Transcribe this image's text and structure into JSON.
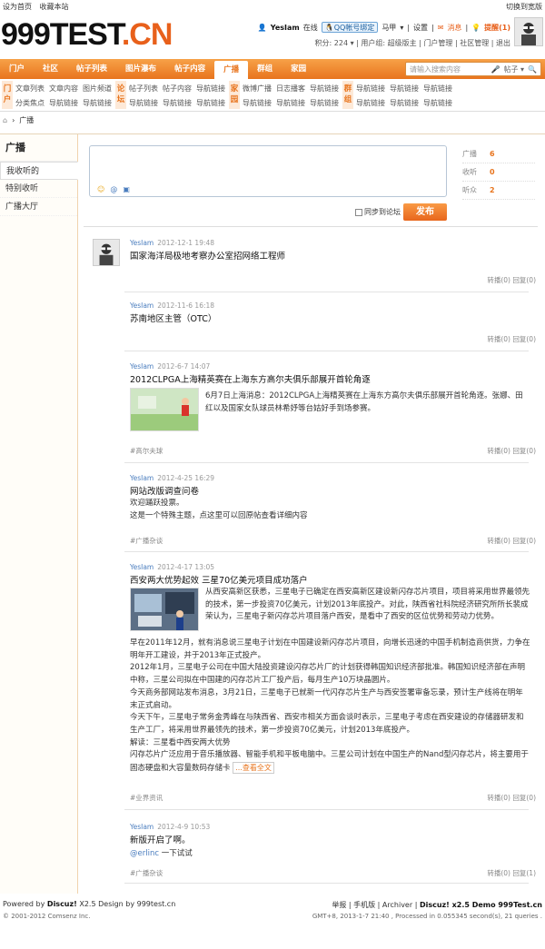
{
  "topbar": {
    "set_home": "设为首页",
    "bookmark": "收藏本站",
    "switch_style": "切换到宽版"
  },
  "logo": {
    "brand": "999TEST",
    "suffix": ".CN"
  },
  "user": {
    "name": "YesIam",
    "status": "在线",
    "qq_bind": "QQ帐号绑定",
    "horse": "马甲",
    "settings": "设置",
    "messages": "消息",
    "reminders": "提醒(1)",
    "credits": "积分: 224",
    "group": "用户组: 超级版主",
    "portal_mgmt": "门户管理",
    "community_mgmt": "社区管理",
    "logout": "退出"
  },
  "nav": {
    "items": [
      "门户",
      "社区",
      "帖子列表",
      "图片瀑布",
      "帖子内容",
      "广播",
      "群组",
      "家园"
    ],
    "search_placeholder": "请输入搜索内容",
    "search_scope": "帖子"
  },
  "subnav": {
    "portal": {
      "tag": "门户",
      "links": [
        "文章列表",
        "文章内容",
        "图片频道",
        "分类焦点",
        "导航链接",
        "导航链接"
      ]
    },
    "forum": {
      "tag": "论坛",
      "links": [
        "帖子列表",
        "帖子内容",
        "导航链接",
        "导航链接",
        "导航链接",
        "导航链接"
      ]
    },
    "home": {
      "tag": "家园",
      "links": [
        "微博广播",
        "日志播客",
        "导航链接",
        "导航链接",
        "导航链接",
        "导航链接"
      ]
    },
    "group": {
      "tag": "群组",
      "links": [
        "导航链接",
        "导航链接",
        "导航链接",
        "导航链接",
        "导航链接",
        "导航链接"
      ]
    }
  },
  "breadcrumb": {
    "current": "广播"
  },
  "sidebar": {
    "title": "广播",
    "items": [
      "我收听的",
      "特别收听",
      "广播大厅"
    ]
  },
  "composer": {
    "sync_label": "同步到论坛",
    "publish": "发布"
  },
  "stats": [
    {
      "label": "广播",
      "value": "6"
    },
    {
      "label": "收听",
      "value": "0"
    },
    {
      "label": "听众",
      "value": "2"
    }
  ],
  "posts": [
    {
      "user": "YesIam",
      "date": "2012-12-1 19:48",
      "title": "国家海洋局极地考察办公室招网络工程师",
      "repost": "转播(0)",
      "reply": "回复(0)"
    },
    {
      "user": "YesIam",
      "date": "2012-11-6 16:18",
      "title": "苏南地区主管（OTC）",
      "repost": "转播(0)",
      "reply": "回复(0)"
    },
    {
      "user": "YesIam",
      "date": "2012-6-7 14:07",
      "title": "2012CLPGA上海精英赛在上海东方高尔夫俱乐部展开首轮角逐",
      "body": "6月7日上海消息：2012CLPGA上海精英赛在上海东方高尔夫俱乐部展开首轮角逐。张娜、田红以及国家女队球员林希妤等台姑好手到场参赛。",
      "tag": "#高尔夫球",
      "repost": "转播(0)",
      "reply": "回复(0)"
    },
    {
      "user": "YesIam",
      "date": "2012-4-25 16:29",
      "title": "网站改版调查问卷",
      "body1": "欢迎踊跃投票。",
      "body2": "这是一个特殊主题，点这里可以回原帖查看详细内容",
      "tag": "#广播杂谈",
      "repost": "转播(0)",
      "reply": "回复(0)"
    },
    {
      "user": "YesIam",
      "date": "2012-4-17 13:05",
      "title": "西安两大优势起效 三星70亿美元项目成功落户",
      "p1": "从西安高新区获悉，三星电子已确定在西安高新区建设新闪存芯片项目，项目将采用世界最领先的技术，第一步投资70亿美元，计划2013年底投产。对此，陕西省社科院经济研究所所长裴成荣认为，三星电子新闪存芯片项目落户西安，是看中了西安的区位优势和劳动力优势。",
      "p2": "早在2011年12月，就有消息说三星电子计划在中国建设新闪存芯片项目，向增长迅速的中国手机制造商供货，力争在明年开工建设，并于2013年正式投产。",
      "p3": "2012年1月，三星电子公司在中国大陆投资建设闪存芯片厂的计划获得韩国知识经济部批准。韩国知识经济部在声明中称，三星公司拟在中国建的闪存芯片工厂投产后，每月生产10万块晶圆片。",
      "p4": "今天商务部网站发布消息，3月21日，三星电子已就新一代闪存芯片生产与西安签署审备忘录，预计生产线将在明年末正式启动。",
      "p5": "今天下午，三星电子常务金秀峰在与陕西省、西安市相关方面会谈时表示，三星电子考虑在西安建设的存储器研发和生产工厂，将采用世界最领先的技术，第一步投资70亿美元，计划2013年底投产。",
      "p6": "解读：三星看中西安两大优势",
      "p7": "闪存芯片广泛应用于音乐播放器、智能手机和平板电脑中。三星公司计划在中国生产的Nand型闪存芯片，将主要用于固态硬盘和大容量数码存储卡",
      "more": "...查看全文",
      "tag": "#业界资讯",
      "repost": "转播(0)",
      "reply": "回复(0)"
    },
    {
      "user": "YesIam",
      "date": "2012-4-9 10:53",
      "title": "新版开启了啊。",
      "mention": "@erlinc",
      "mention_text": " 一下试试",
      "tag": "#广播杂谈",
      "repost": "转播(0)",
      "reply": "回复(1)"
    }
  ],
  "footer": {
    "powered": "Powered by",
    "discuz": "Discuz!",
    "ver": "X2.5 Design by 999test.cn",
    "copyright": "© 2001-2012 Comsenz Inc.",
    "report": "举报",
    "mobile": "手机版",
    "archiver": "Archiver",
    "demo": "Discuz! x2.5 Demo 999Test.cn",
    "gmt": "GMT+8, 2013-1-7 21:40 , Processed in 0.055345 second(s), 21 queries ."
  }
}
